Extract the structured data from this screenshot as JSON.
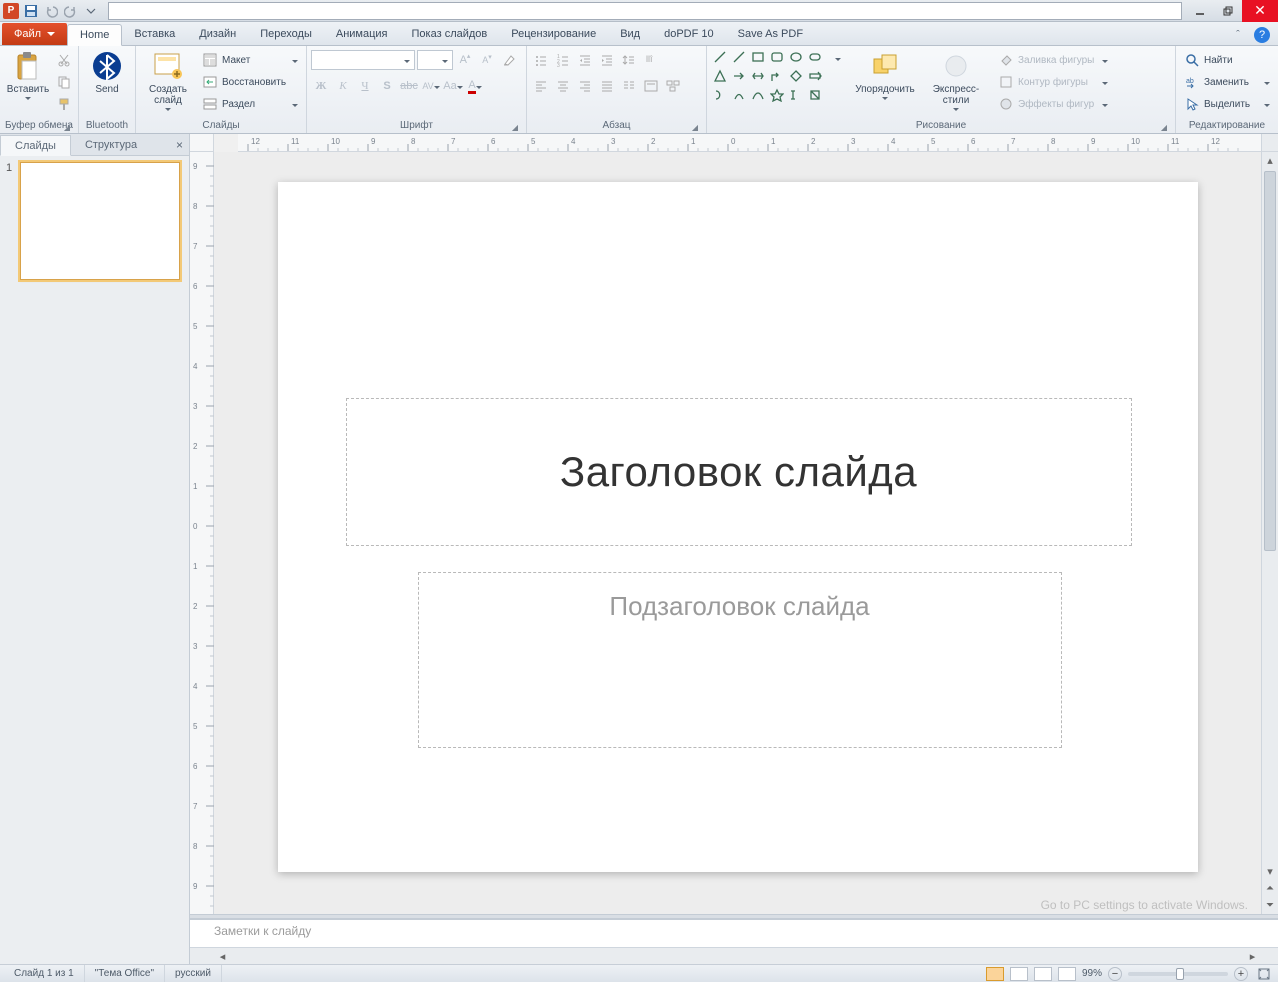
{
  "qat": {
    "save_tooltip": "Сохранить"
  },
  "tabs": {
    "file": "Файл",
    "items": [
      "Home",
      "Вставка",
      "Дизайн",
      "Переходы",
      "Анимация",
      "Показ слайдов",
      "Рецензирование",
      "Вид",
      "doPDF 10",
      "Save As PDF"
    ],
    "active": "Home"
  },
  "ribbon": {
    "clipboard": {
      "paste": "Вставить",
      "label": "Буфер обмена"
    },
    "bluetooth": {
      "send": "Send",
      "label": "Bluetooth"
    },
    "slides": {
      "new_slide": "Создать\nслайд",
      "layout": "Макет",
      "reset": "Восстановить",
      "section": "Раздел",
      "label": "Слайды"
    },
    "font": {
      "label": "Шрифт"
    },
    "paragraph": {
      "label": "Абзац"
    },
    "drawing": {
      "arrange": "Упорядочить",
      "quick_styles": "Экспресс-стили",
      "shape_fill": "Заливка фигуры",
      "shape_outline": "Контур фигуры",
      "shape_effects": "Эффекты фигур",
      "label": "Рисование"
    },
    "editing": {
      "find": "Найти",
      "replace": "Заменить",
      "select": "Выделить",
      "label": "Редактирование"
    }
  },
  "sidepanel": {
    "tabs": [
      "Слайды",
      "Структура"
    ],
    "close": "×",
    "slide_num": "1"
  },
  "slide": {
    "title_placeholder": "Заголовок слайда",
    "subtitle_placeholder": "Подзаголовок слайда"
  },
  "notes": {
    "placeholder": "Заметки к слайду"
  },
  "watermark": "Go to PC settings to activate Windows.",
  "status": {
    "slide_of": "Слайд 1 из 1",
    "theme": "\"Тема Office\"",
    "lang": "русский",
    "zoom": "99%"
  }
}
